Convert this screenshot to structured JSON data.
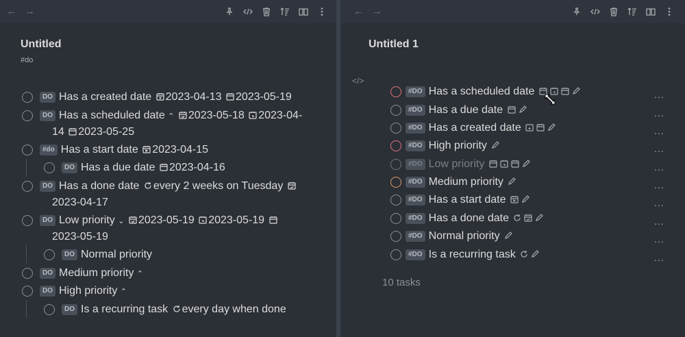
{
  "nav": {
    "back": "←",
    "forward": "→"
  },
  "left": {
    "title": "Untitled",
    "tag": "#do",
    "tasks": [
      {
        "tag": "DO",
        "text": "Has a created date",
        "d1": "2023-04-13",
        "d2": "2023-05-19"
      },
      {
        "tag": "DO",
        "text": "Has a scheduled date",
        "d1": "2023-05-18",
        "d2": "2023-04-",
        "d3": "14",
        "d4": "2023-05-25"
      },
      {
        "tag": "#do",
        "text": "Has a start date",
        "d1": "2023-04-15"
      },
      {
        "tag": "DO",
        "text": "Has a due date",
        "d1": "2023-04-16"
      },
      {
        "tag": "DO",
        "text": "Has a done date",
        "rec": "every 2 weeks on Tuesday",
        "d1": "2023-04-17"
      },
      {
        "tag": "DO",
        "text": "Low priority",
        "d1": "2023-05-19",
        "d2": "2023-05-19",
        "d3": "2023-05-19"
      },
      {
        "tag": "DO",
        "text": "Normal priority"
      },
      {
        "tag": "DO",
        "text": "Medium priority"
      },
      {
        "tag": "DO",
        "text": "High priority"
      },
      {
        "tag": "DO",
        "text": "Is a recurring task",
        "rec": "every day when done"
      }
    ]
  },
  "right": {
    "title": "Untitled 1",
    "more": "...",
    "count": "10 tasks",
    "tasks": [
      {
        "tag": "#DO",
        "text": "Has a scheduled date"
      },
      {
        "tag": "#DO",
        "text": "Has a due date"
      },
      {
        "tag": "#DO",
        "text": "Has a created date"
      },
      {
        "tag": "#DO",
        "text": "High priority"
      },
      {
        "tag": "#DO",
        "text": "Low priority"
      },
      {
        "tag": "#DO",
        "text": "Medium priority"
      },
      {
        "tag": "#DO",
        "text": "Has a start date"
      },
      {
        "tag": "#DO",
        "text": "Has a done date"
      },
      {
        "tag": "#DO",
        "text": "Normal priority"
      },
      {
        "tag": "#DO",
        "text": "Is a recurring task"
      }
    ]
  },
  "colors": {
    "high": "#e0737a",
    "medium": "#d99a6c",
    "low_check": "#6f747c"
  }
}
